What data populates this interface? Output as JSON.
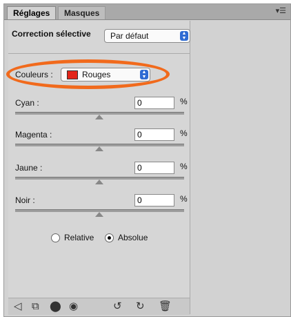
{
  "tabs": [
    {
      "label": "Réglages",
      "active": true
    },
    {
      "label": "Masques",
      "active": false
    }
  ],
  "panel_menu_icon": "panel-menu-icon",
  "header": {
    "title": "Correction sélective",
    "preset_value": "Par défaut"
  },
  "colors": {
    "label": "Couleurs :",
    "value": "Rouges",
    "swatch_color": "#e3261a"
  },
  "sliders": [
    {
      "label": "Cyan :",
      "value": "0",
      "unit": "%"
    },
    {
      "label": "Magenta :",
      "value": "0",
      "unit": "%"
    },
    {
      "label": "Jaune :",
      "value": "0",
      "unit": "%"
    },
    {
      "label": "Noir :",
      "value": "0",
      "unit": "%"
    }
  ],
  "method": {
    "options": [
      "Relative",
      "Absolue"
    ],
    "selected": "Absolue"
  },
  "annotation_color": "#f16a1c",
  "bottom_icons": [
    "back-arrow-icon",
    "clip-layer-icon",
    "visibility-toggle-icon",
    "eye-icon",
    "reset-icon",
    "undo-icon",
    "trash-icon"
  ]
}
